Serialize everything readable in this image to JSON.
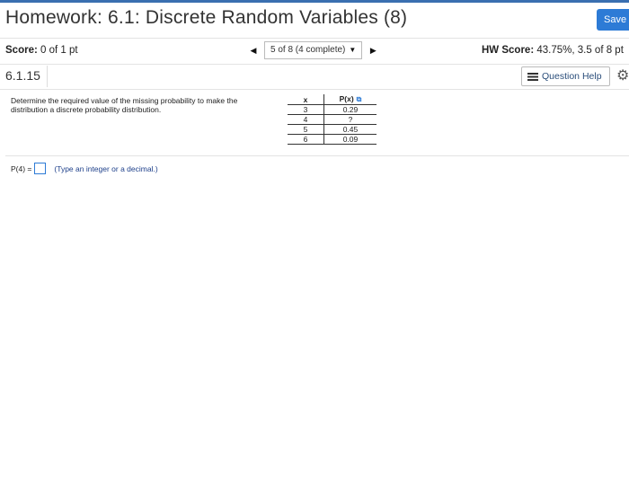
{
  "header": {
    "title": "Homework: 6.1: Discrete Random Variables (8)",
    "save_label": "Save"
  },
  "score_bar": {
    "score_label": "Score:",
    "score_value": "0 of 1 pt",
    "question_nav": "5 of 8 (4 complete)",
    "hw_score_label": "HW Score:",
    "hw_score_value": "43.75%, 3.5 of 8 pt"
  },
  "question_bar": {
    "number": "6.1.15",
    "help_label": "Question Help"
  },
  "question": {
    "prompt": "Determine the required value of the missing probability to make the distribution a discrete probability distribution.",
    "table": {
      "headers": [
        "x",
        "P(x)"
      ],
      "rows": [
        {
          "x": "3",
          "p": "0.29"
        },
        {
          "x": "4",
          "p": "?"
        },
        {
          "x": "5",
          "p": "0.45"
        },
        {
          "x": "6",
          "p": "0.09"
        }
      ]
    },
    "answer_label": "P(4) =",
    "answer_value": "",
    "hint": "(Type an integer or a decimal.)"
  },
  "icons": {
    "prev": "left-triangle-icon",
    "next": "right-triangle-icon",
    "dropdown": "down-triangle-icon",
    "help": "list-icon",
    "settings": "gear-icon",
    "copy": "copy-icon"
  }
}
